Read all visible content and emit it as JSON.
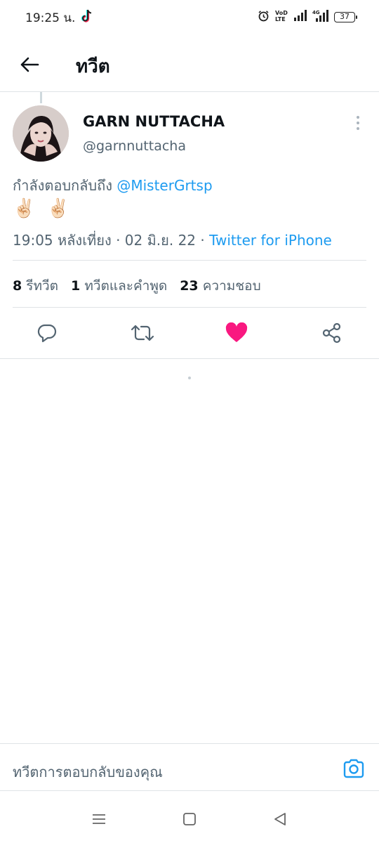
{
  "status_bar": {
    "time": "19:25 น.",
    "battery": "37",
    "icons": [
      "tiktok-icon",
      "alarm-icon",
      "volte-icon",
      "signal-icon",
      "4g-signal-icon",
      "battery-icon"
    ]
  },
  "header": {
    "title": "ทวีต",
    "back_icon": "arrow-left-icon"
  },
  "tweet": {
    "author_name": "GARN NUTTACHA",
    "author_handle": "@garnnuttacha",
    "reply_prefix": "กำลังตอบกลับถึง",
    "reply_to": "@MisterGrtsp",
    "body": "✌🏻 ✌🏻",
    "time": "19:05 หลังเที่ยง",
    "date": "02 มิ.ย. 22",
    "separator": "·",
    "source": "Twitter for iPhone"
  },
  "stats": {
    "retweets_count": "8",
    "retweets_label": "รีทวีต",
    "quotes_count": "1",
    "quotes_label": "ทวีตและคำพูด",
    "likes_count": "23",
    "likes_label": "ความชอบ"
  },
  "actions": {
    "icons": [
      "reply-icon",
      "retweet-icon",
      "like-icon",
      "share-icon"
    ],
    "like_active": true,
    "like_color": "#f91880",
    "icon_color": "#536471"
  },
  "compose": {
    "placeholder": "ทวีตการตอบกลับของคุณ",
    "camera_icon": "camera-icon",
    "accent": "#1d9bf0"
  },
  "nav_bar": {
    "icons": [
      "menu-icon",
      "home-square-icon",
      "back-triangle-icon"
    ]
  }
}
